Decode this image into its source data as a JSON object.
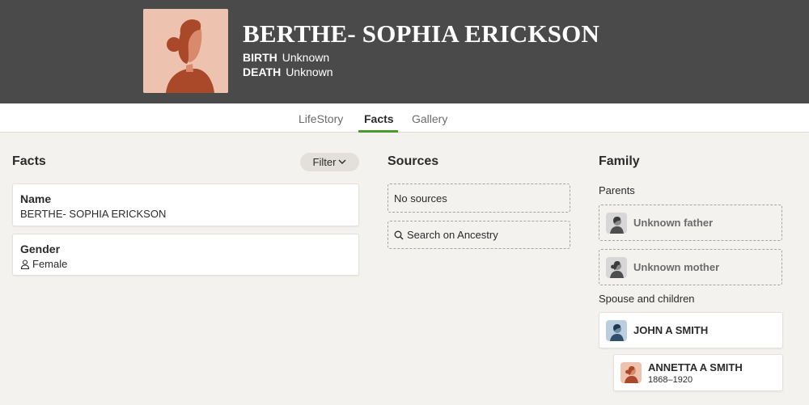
{
  "header": {
    "name": "BERTHE- SOPHIA ERICKSON",
    "birth_label": "BIRTH",
    "birth_value": "Unknown",
    "death_label": "DEATH",
    "death_value": "Unknown",
    "background_color": "#4a4a4a",
    "portrait_icon": "female-silhouette-icon"
  },
  "tabs": [
    {
      "label": "LifeStory",
      "active": false
    },
    {
      "label": "Facts",
      "active": true
    },
    {
      "label": "Gallery",
      "active": false
    }
  ],
  "accent_color": "#4a9a2b",
  "facts": {
    "title": "Facts",
    "filter_label": "Filter",
    "items": [
      {
        "label": "Name",
        "value": "BERTHE- SOPHIA ERICKSON"
      },
      {
        "label": "Gender",
        "value": "Female",
        "icon": "person-icon"
      }
    ]
  },
  "sources": {
    "title": "Sources",
    "no_sources": "No sources",
    "search_label": "Search on Ancestry"
  },
  "family": {
    "title": "Family",
    "parents_label": "Parents",
    "father": "Unknown father",
    "mother": "Unknown mother",
    "spouse_label": "Spouse and children",
    "spouse": {
      "name": "JOHN A SMITH"
    },
    "child": {
      "name": "ANNETTA A SMITH",
      "dates": "1868–1920"
    }
  }
}
